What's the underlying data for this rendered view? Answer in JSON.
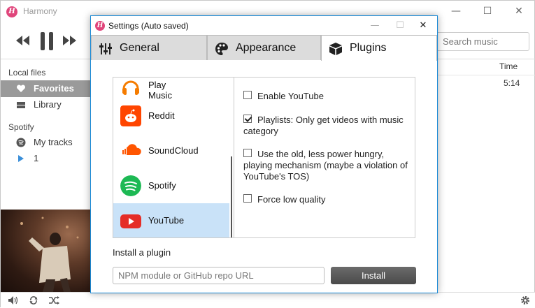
{
  "app": {
    "title": "Harmony",
    "logo_letter": "H"
  },
  "window_controls": {
    "minimize": "—",
    "maximize": "☐",
    "close": "✕"
  },
  "search": {
    "placeholder": "Search music"
  },
  "sidebar": {
    "local_heading": "Local files",
    "local_items": [
      {
        "label": "Favorites",
        "icon": "heart-icon"
      },
      {
        "label": "Library",
        "icon": "library-icon"
      }
    ],
    "spotify_heading": "Spotify",
    "spotify_items": [
      {
        "label": "My tracks",
        "icon": "spotify-icon"
      },
      {
        "label": "1",
        "icon": "play-triangle-icon"
      }
    ]
  },
  "content": {
    "time_header": "Time",
    "rows": [
      {
        "time": "5:14"
      }
    ]
  },
  "dialog": {
    "title": "Settings (Auto saved)",
    "tabs": [
      {
        "label": "General",
        "icon": "sliders-icon"
      },
      {
        "label": "Appearance",
        "icon": "palette-icon"
      },
      {
        "label": "Plugins",
        "icon": "cube-icon"
      }
    ],
    "active_tab": "Plugins",
    "plugins": [
      {
        "label": "Play Music",
        "icon": "headphones-icon",
        "color": "#f57c00"
      },
      {
        "label": "Reddit",
        "icon": "reddit-icon",
        "color": "#ff4500"
      },
      {
        "label": "SoundCloud",
        "icon": "soundcloud-icon",
        "color": "#ff5500"
      },
      {
        "label": "Spotify",
        "icon": "spotify-icon",
        "color": "#1db954"
      },
      {
        "label": "YouTube",
        "icon": "youtube-icon",
        "color": "#e52d27"
      }
    ],
    "selected_plugin": "YouTube",
    "options": [
      {
        "label": "Enable YouTube",
        "checked": false
      },
      {
        "label": "Playlists: Only get videos with music category",
        "checked": true
      },
      {
        "label": "Use the old, less power hungry, playing mechanism (maybe a violation of YouTube's TOS)",
        "checked": false
      },
      {
        "label": "Force low quality",
        "checked": false
      }
    ],
    "install": {
      "heading": "Install a plugin",
      "placeholder": "NPM module or GitHub repo URL",
      "button_label": "Install"
    }
  }
}
